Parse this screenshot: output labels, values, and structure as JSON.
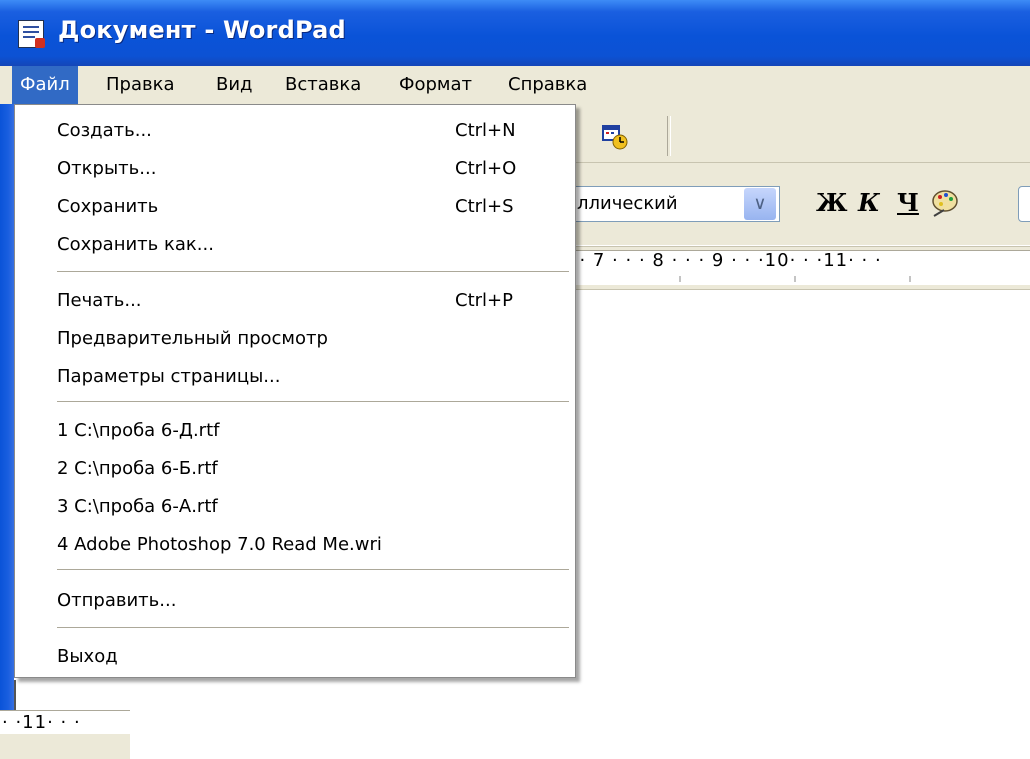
{
  "window": {
    "title": "Документ - WordPad"
  },
  "menubar": {
    "items": [
      "Файл",
      "Правка",
      "Вид",
      "Вставка",
      "Формат",
      "Справка"
    ]
  },
  "toolbar": {
    "font_name": "ллический",
    "bold_label": "Ж",
    "italic_label": "К",
    "underline_label": "Ч"
  },
  "ruler": {
    "text": "· · 7 · · · 8 · · · 9 · · ·10· · ·11· · ·"
  },
  "file_menu": {
    "items": [
      {
        "label": "Создать...",
        "shortcut": "Ctrl+N"
      },
      {
        "label": "Открыть...",
        "shortcut": "Ctrl+O"
      },
      {
        "label": "Сохранить",
        "shortcut": "Ctrl+S"
      },
      {
        "label": "Сохранить как...",
        "shortcut": ""
      },
      {
        "label": "Печать...",
        "shortcut": "Ctrl+P"
      },
      {
        "label": "Предварительный просмотр",
        "shortcut": ""
      },
      {
        "label": "Параметры страницы...",
        "shortcut": ""
      },
      {
        "label": "1 C:\\проба 6-Д.rtf",
        "shortcut": ""
      },
      {
        "label": "2 C:\\проба 6-Б.rtf",
        "shortcut": ""
      },
      {
        "label": "3 C:\\проба 6-А.rtf",
        "shortcut": ""
      },
      {
        "label": "4 Adobe Photoshop 7.0 Read Me.wri",
        "shortcut": ""
      },
      {
        "label": "Отправить...",
        "shortcut": ""
      },
      {
        "label": "Выход",
        "shortcut": ""
      }
    ]
  },
  "bottom_ruler": {
    "text": "· ·11· · ·"
  },
  "colors": {
    "titlebar": "#0a53d8",
    "menu_highlight": "#316ac5",
    "chrome": "#ece9d8"
  }
}
